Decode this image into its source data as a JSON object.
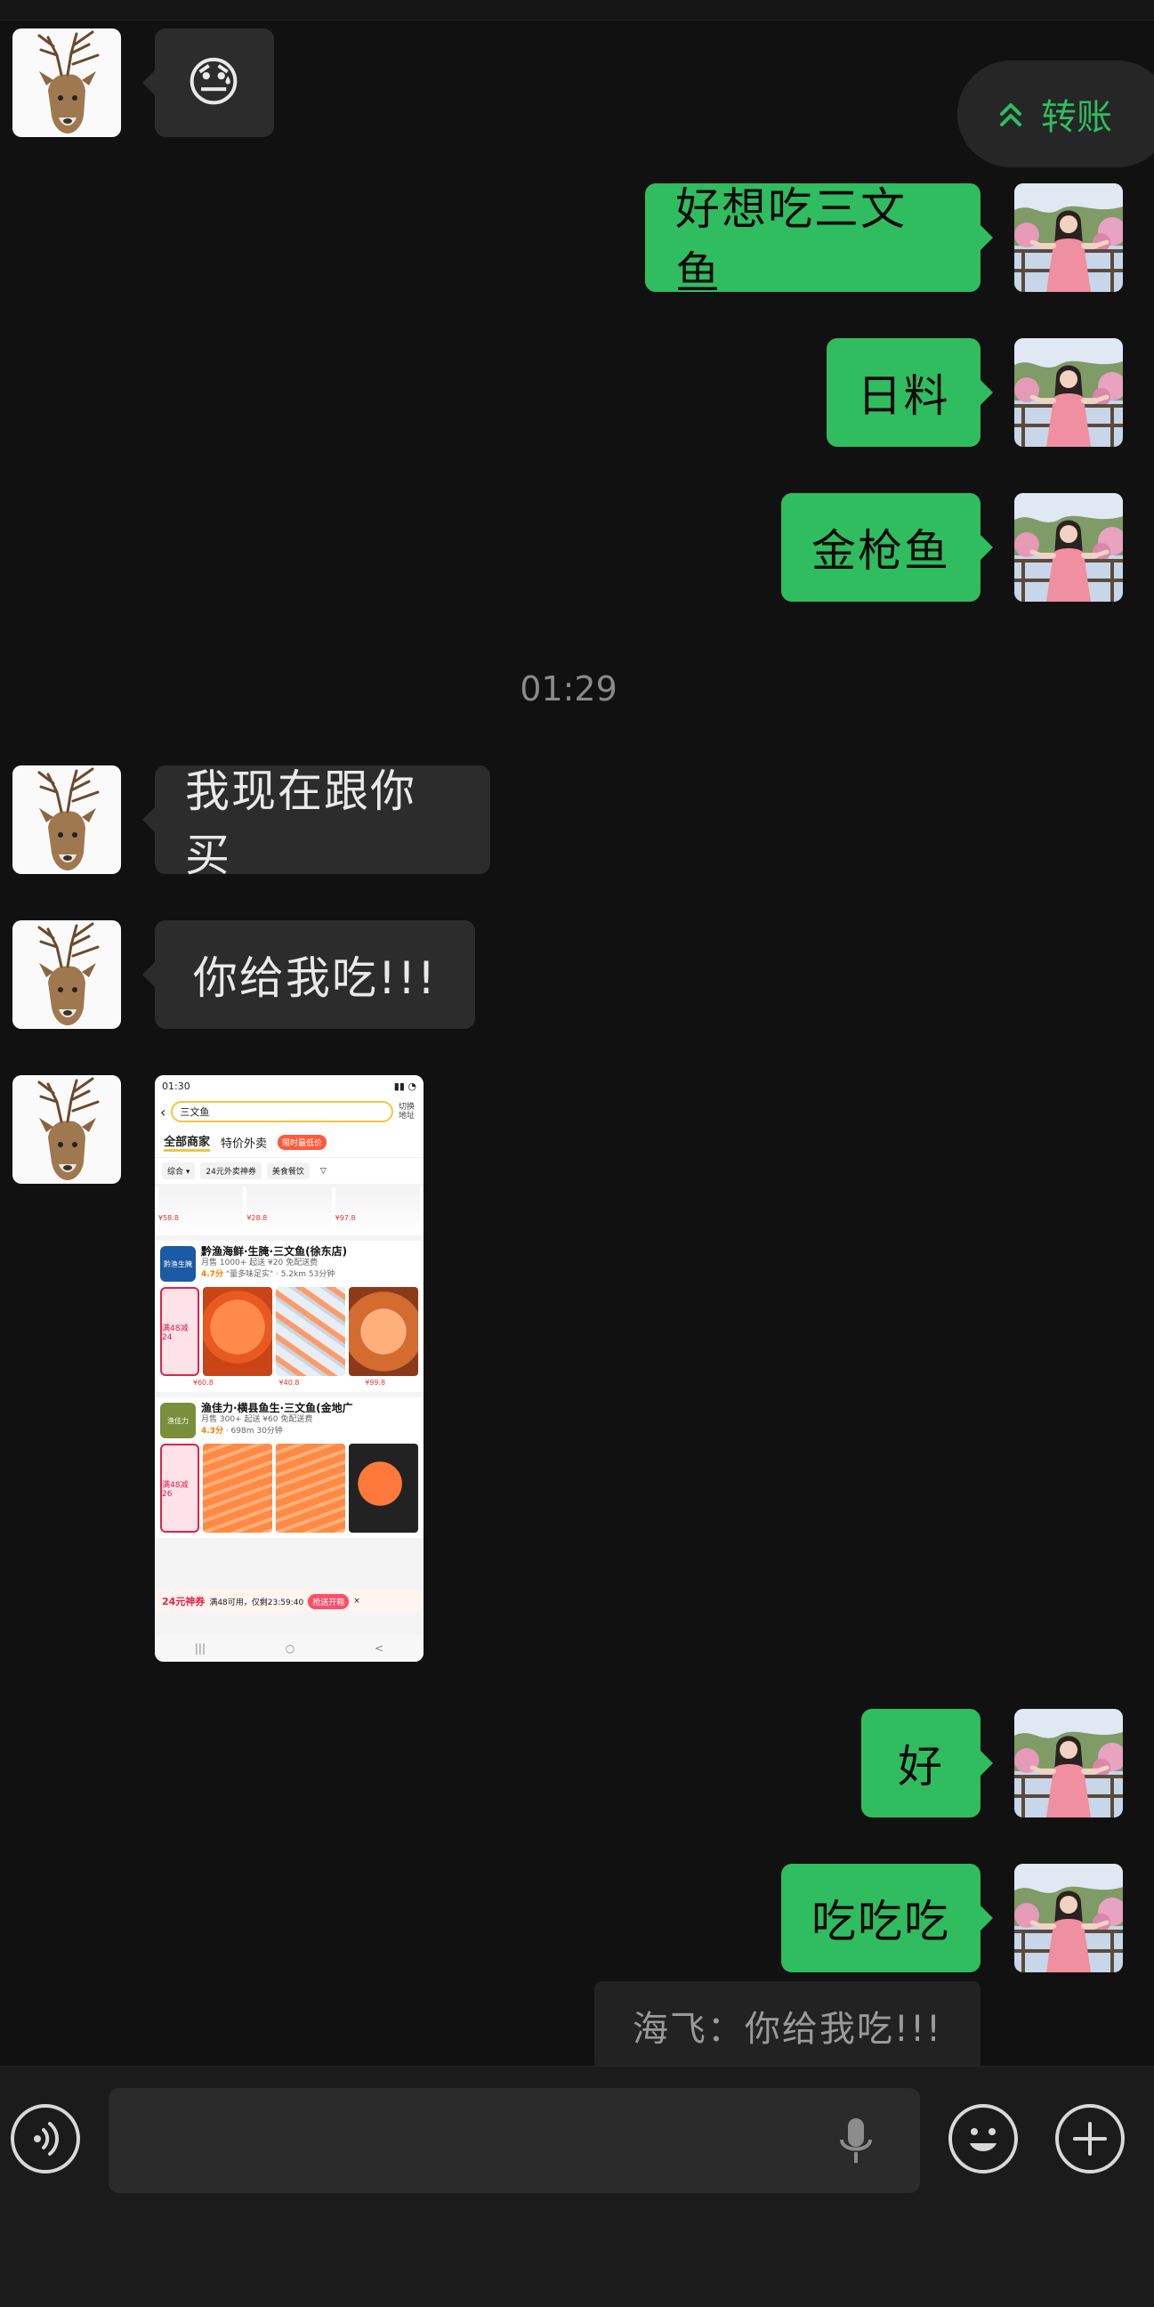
{
  "messages": [
    {
      "side": "in",
      "text": "😓"
    },
    {
      "side": "out",
      "text": "好想吃三文鱼"
    },
    {
      "side": "out",
      "text": "日料"
    },
    {
      "side": "out",
      "text": "金枪鱼"
    },
    {
      "side": "in",
      "text": "我现在跟你买"
    },
    {
      "side": "in",
      "text": "你给我吃!!!"
    },
    {
      "side": "out",
      "text": "好"
    },
    {
      "side": "out",
      "text": "吃吃吃"
    }
  ],
  "timestamp": "01:29",
  "transfer_label": "转账",
  "quote_text": "海飞：你给我吃!!!",
  "shared_screenshot": {
    "status_time": "01:30",
    "search_text": "三文鱼",
    "switch_label": "切换地址",
    "tabs": [
      "全部商家",
      "特价外卖"
    ],
    "promo": "限时最低价",
    "filters": [
      "综合 ▾",
      "24元外卖神券",
      "美食餐饮"
    ],
    "strip_prices": [
      "¥58.8",
      "¥28.8",
      "¥97.8"
    ],
    "stores": [
      {
        "name": "黔渔海鲜·生腌·三文鱼(徐东店)",
        "logo": "黔渔生腌",
        "meta": "月售 1000+  起送 ¥20  免配送费",
        "distance": "5.2km 53分钟",
        "score": "4.7分",
        "quote": "\"量多味足实\"",
        "discount": "满48减24",
        "prices": [
          "¥60.8",
          "¥40.8",
          "¥99.8"
        ]
      },
      {
        "name": "渔佳力·横县鱼生·三文鱼(金地广",
        "logo": "渔佳力",
        "meta": "月售 300+  起送 ¥60  免配送费",
        "distance": "698m 30分钟",
        "score": "4.3分",
        "discount": "满48减26",
        "prices": [
          "",
          "",
          ""
        ]
      }
    ],
    "coupon_amount": "24元神券",
    "coupon_text": "满48可用，仅剩23:59:40",
    "coupon_button": "抢送开箱",
    "nav": [
      "|||",
      "○",
      "<"
    ]
  },
  "colors": {
    "outgoing": "#2fbd5f",
    "incoming": "#2c2c2c",
    "background": "#111111"
  },
  "icons": {
    "voice": "voice-icon",
    "mic": "mic-icon",
    "emoji": "emoji-icon",
    "plus": "plus-icon"
  }
}
